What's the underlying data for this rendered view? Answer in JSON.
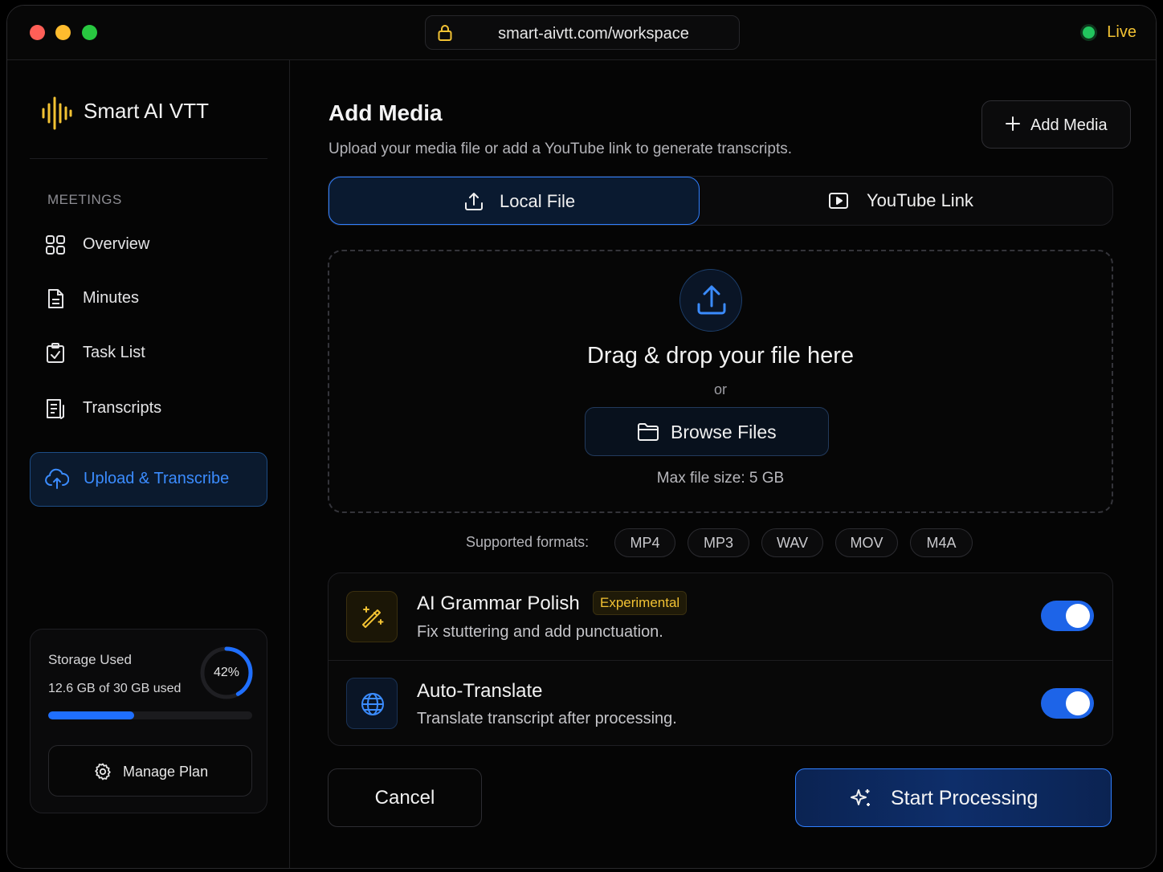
{
  "browser": {
    "url": "smart-aivtt.com/workspace",
    "status": "Live"
  },
  "sidebar": {
    "brand": "Smart AI VTT",
    "section_label": "MEETINGS",
    "items": [
      {
        "label": "Overview",
        "icon": "grid-icon"
      },
      {
        "label": "Minutes",
        "icon": "document-icon"
      },
      {
        "label": "Task List",
        "icon": "clipboard-check-icon"
      },
      {
        "label": "Transcripts",
        "icon": "transcript-icon"
      },
      {
        "label": "Upload & Transcribe",
        "icon": "cloud-upload-icon",
        "active": true
      }
    ],
    "storage": {
      "title": "Storage Used",
      "usage": "12.6 GB of 30 GB used",
      "percent_label": "42%",
      "percent": 42,
      "manage_label": "Manage Plan"
    }
  },
  "main": {
    "title": "Add Media",
    "subtitle": "Upload your media file or add a YouTube link to generate transcripts.",
    "add_button": "Add Media",
    "tabs": [
      {
        "label": "Local File",
        "icon": "upload-icon",
        "active": true
      },
      {
        "label": "YouTube Link",
        "icon": "play-box-icon",
        "active": false
      }
    ],
    "dropzone": {
      "title": "Drag & drop your file here",
      "or": "or",
      "browse_label": "Browse Files",
      "max_size": "Max file size: 5 GB"
    },
    "formats": {
      "label": "Supported formats:",
      "items": [
        "MP4",
        "MP3",
        "WAV",
        "MOV",
        "M4A"
      ]
    },
    "options": [
      {
        "title": "AI Grammar Polish",
        "badge": "Experimental",
        "description": "Fix stuttering and add punctuation.",
        "enabled": true,
        "icon": "magic-wand-icon"
      },
      {
        "title": "Auto-Translate",
        "description": "Translate transcript after processing.",
        "enabled": true,
        "icon": "globe-icon"
      }
    ],
    "cancel_label": "Cancel",
    "start_label": "Start Processing"
  },
  "colors": {
    "accent": "#2f7fff",
    "background": "#050505",
    "warning": "#f2c233",
    "live": "#22c55e"
  }
}
